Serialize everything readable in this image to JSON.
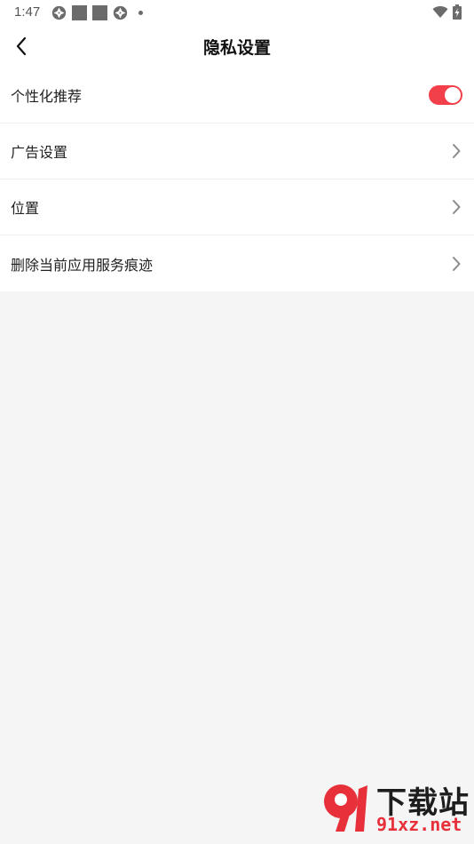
{
  "status_bar": {
    "time": "1:47"
  },
  "header": {
    "title": "隐私设置"
  },
  "settings": {
    "items": [
      {
        "label": "个性化推荐",
        "control": "toggle",
        "toggle_on": true
      },
      {
        "label": "广告设置",
        "control": "chevron"
      },
      {
        "label": "位置",
        "control": "chevron"
      },
      {
        "label": "删除当前应用服务痕迹",
        "control": "chevron"
      }
    ]
  },
  "colors": {
    "accent": "#f2404b",
    "background": "#f5f5f5"
  },
  "watermark": {
    "logo": "91",
    "top": "下载站",
    "bottom": "91xz.net"
  }
}
